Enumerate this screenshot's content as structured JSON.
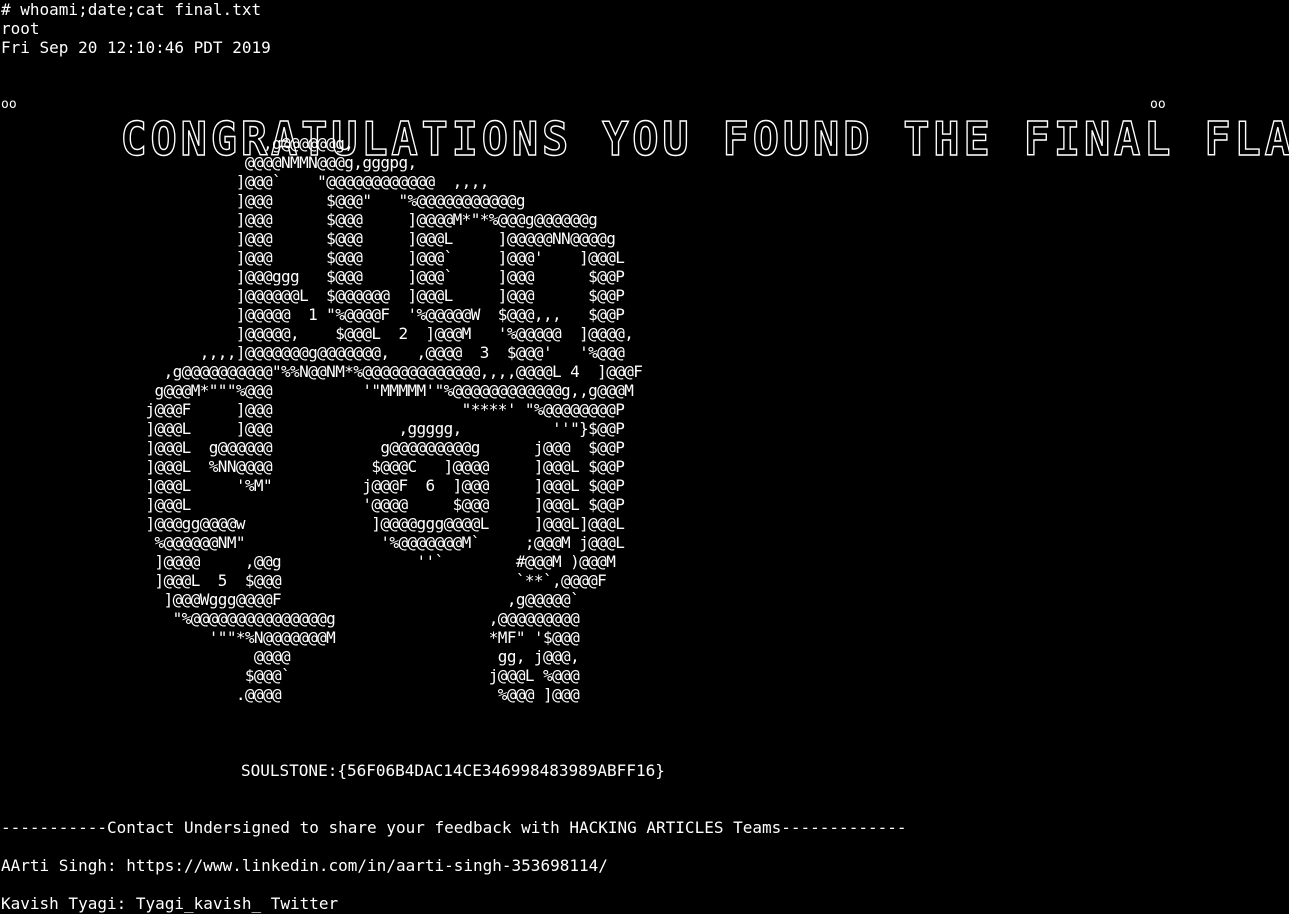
{
  "terminal": {
    "command": "# whoami;date;cat final.txt",
    "user": "root",
    "date": "Fri Sep 20 12:10:46 PDT 2019",
    "banner": "CONGRATULATIONS YOU FOUND THE FINAL FLAG !!",
    "ascii_art": "                             ,g@@@@@@g,\n                           @@@@NMMN@@@g,gggpg,\n                          ]@@@`    \"@@@@@@@@@@@@  ,,,,\n                          ]@@@      $@@@\"   \"%@@@@@@@@@@@g\n                          ]@@@      $@@@     ]@@@@M*\"*%@@@g@@@@@@g\n                          ]@@@      $@@@     ]@@@L     ]@@@@@NN@@@@g\n                          ]@@@      $@@@     ]@@@`     ]@@@'    ]@@@L\n                          ]@@@ggg   $@@@     ]@@@`     ]@@@      $@@P\n                          ]@@@@@@L  $@@@@@@  ]@@@L     ]@@@      $@@P\n                          ]@@@@@  1 \"%@@@@F  '%@@@@@W  $@@@,,,   $@@P\n                          ]@@@@@,    $@@@L  2  ]@@@M   '%@@@@@  ]@@@@,\n                      ,,,,]@@@@@@@g@@@@@@@,   ,@@@@  3  $@@@'   '%@@@\n                  ,g@@@@@@@@@@\"%%N@@NM*%@@@@@@@@@@@@@,,,,@@@@L 4  ]@@@F\n                 g@@@M*\"\"\"%@@@          '\"MMMMM'\"%@@@@@@@@@@@@g,,g@@@M\n                j@@@F     ]@@@                     \"****' \"%@@@@@@@@P\n                ]@@@L     ]@@@              ,ggggg,          ''\"}$@@P\n                ]@@@L  g@@@@@@            g@@@@@@@@@g      j@@@  $@@P\n                ]@@@L  %NN@@@@           $@@@C   ]@@@@     ]@@@L $@@P\n                ]@@@L     '%M\"          j@@@F  6  ]@@@     ]@@@L $@@P\n                ]@@@L                   '@@@@     $@@@     ]@@@L $@@P\n                ]@@@gg@@@@w              ]@@@@ggg@@@@L     ]@@@L]@@@L\n                 %@@@@@@NM\"               '%@@@@@@@M`     ;@@@M j@@@L\n                 ]@@@@     ,@@g               ''`        #@@@M )@@@M\n                 ]@@@L  5  $@@@                          `**`,@@@@F\n                  ]@@@Wggg@@@@F                         ,g@@@@@`\n                   \"%@@@@@@@@@@@@@@@g                 ,@@@@@@@@@\n                       '\"\"*%N@@@@@@@M                 *MF\" '$@@@\n                            @@@@                       gg, j@@@,\n                           $@@@`                      j@@@L %@@@\n                          .@@@@                        %@@@ ]@@@",
    "flag": "SOULSTONE:{56F06B4DAC14CE346998483989ABFF16}",
    "contact_line": "-----------Contact Undersigned to share your feedback with HACKING ARTICLES Teams-------------",
    "contact_1": "AArti Singh: https://www.linkedin.com/in/aarti-singh-353698114/",
    "contact_2": "Kavish Tyagi: Tyagi_kavish_ Twitter"
  },
  "colors": {
    "background": "#000000",
    "foreground": "#ffffff"
  }
}
